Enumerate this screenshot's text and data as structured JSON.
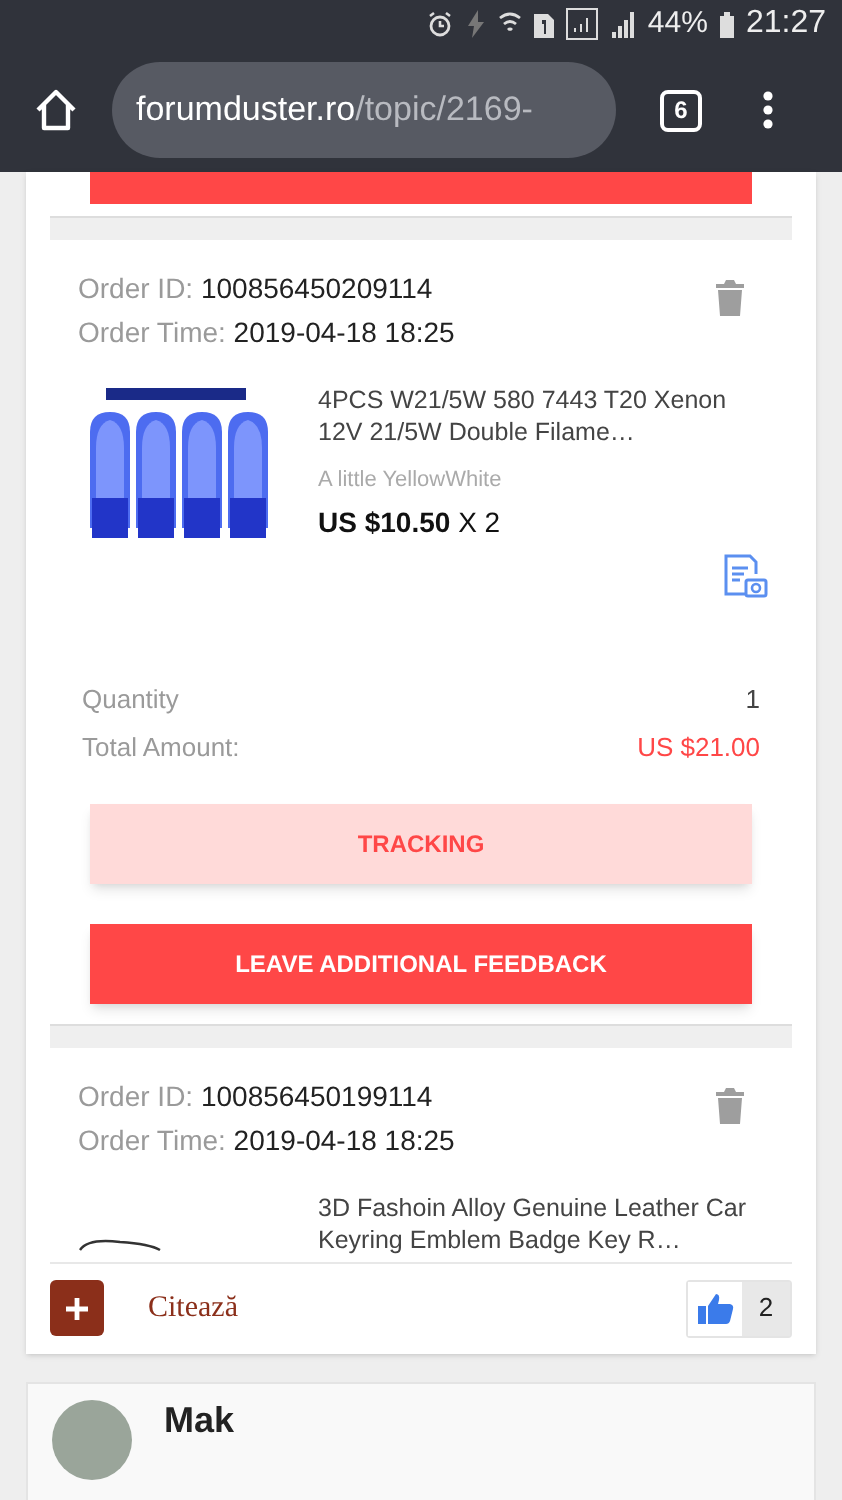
{
  "status_bar": {
    "battery": "44%",
    "time": "21:27"
  },
  "browser": {
    "url_domain": "forumduster.ro",
    "url_path": "/topic/2169-",
    "tab_count": "6"
  },
  "orders": [
    {
      "id_label": "Order ID:",
      "id": "100856450209114",
      "time_label": "Order Time:",
      "time": "2019-04-18 18:25",
      "product": {
        "kind": "bulbs",
        "title": "4PCS W21/5W 580 7443 T20 Xenon 12V 21/5W Double Filame…",
        "variant": "A little YellowWhite",
        "price": "US $10.50",
        "quantity": "X 2"
      },
      "quantity_label": "Quantity",
      "quantity": "1",
      "total_label": "Total Amount:",
      "total": "US $21.00",
      "buttons": [
        {
          "label": "TRACKING",
          "kind": "secondary"
        },
        {
          "label": "LEAVE ADDITIONAL FEEDBACK",
          "kind": "primary"
        }
      ]
    },
    {
      "id_label": "Order ID:",
      "id": "100856450199114",
      "time_label": "Order Time:",
      "time": "2019-04-18 18:25",
      "product": {
        "kind": "keyring",
        "title": "3D Fashoin Alloy Genuine Leather Car Keyring Emblem Badge Key R…"
      }
    }
  ],
  "post_footer": {
    "quote_label": "Citează",
    "likes": "2"
  },
  "next_post": {
    "author": "Mak"
  }
}
